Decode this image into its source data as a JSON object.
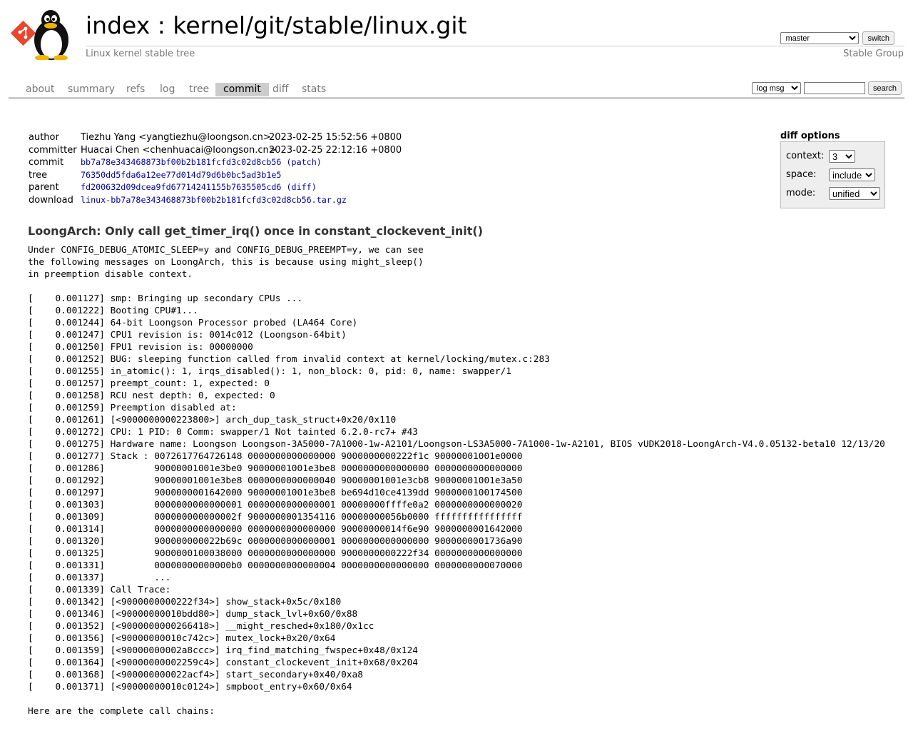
{
  "header": {
    "index_link": "index",
    "separator": ":",
    "repo_path": "kernel/git/stable/linux.git",
    "subtitle": "Linux kernel stable tree",
    "owner": "Stable Group",
    "branch_select": "master",
    "switch_button": "switch"
  },
  "tabs": [
    {
      "label": "about"
    },
    {
      "label": "summary"
    },
    {
      "label": "refs"
    },
    {
      "label": "log"
    },
    {
      "label": "tree"
    },
    {
      "label": "commit",
      "active": true
    },
    {
      "label": "diff"
    },
    {
      "label": "stats"
    }
  ],
  "search": {
    "mode_select": "log msg",
    "input_value": "",
    "button": "search"
  },
  "commit_info": {
    "author_label": "author",
    "author_value": "Tiezhu Yang <yangtiezhu@loongson.cn>",
    "author_date": "2023-02-25 15:52:56 +0800",
    "committer_label": "committer",
    "committer_value": "Huacai Chen <chenhuacai@loongson.cn>",
    "committer_date": "2023-02-25 22:12:16 +0800",
    "commit_label": "commit",
    "commit_hash": "bb7a78e343468873bf00b2b181fcfd3c02d8cb56",
    "commit_patch": "(patch)",
    "tree_label": "tree",
    "tree_hash": "76350dd5fda6a12ee77d014d79d6b0bc5ad3b1e5",
    "parent_label": "parent",
    "parent_hash": "fd200632d09dcea9fd67714241155b7635505cd6",
    "parent_diff": "(diff)",
    "download_label": "download",
    "download_link": "linux-bb7a78e343468873bf00b2b181fcfd3c02d8cb56.tar.gz"
  },
  "diff_options": {
    "title": "diff options",
    "context_label": "context:",
    "context_value": "3",
    "space_label": "space:",
    "space_value": "include",
    "mode_label": "mode:",
    "mode_value": "unified"
  },
  "commit_subject": "LoongArch: Only call get_timer_irq() once in constant_clockevent_init()",
  "commit_message": "Under CONFIG_DEBUG_ATOMIC_SLEEP=y and CONFIG_DEBUG_PREEMPT=y, we can see\nthe following messages on LoongArch, this is because using might_sleep()\nin preemption disable context.\n\n[    0.001127] smp: Bringing up secondary CPUs ...\n[    0.001222] Booting CPU#1...\n[    0.001244] 64-bit Loongson Processor probed (LA464 Core)\n[    0.001247] CPU1 revision is: 0014c012 (Loongson-64bit)\n[    0.001250] FPU1 revision is: 00000000\n[    0.001252] BUG: sleeping function called from invalid context at kernel/locking/mutex.c:283\n[    0.001255] in_atomic(): 1, irqs_disabled(): 1, non_block: 0, pid: 0, name: swapper/1\n[    0.001257] preempt_count: 1, expected: 0\n[    0.001258] RCU nest depth: 0, expected: 0\n[    0.001259] Preemption disabled at:\n[    0.001261] [<9000000000223800>] arch_dup_task_struct+0x20/0x110\n[    0.001272] CPU: 1 PID: 0 Comm: swapper/1 Not tainted 6.2.0-rc7+ #43\n[    0.001275] Hardware name: Loongson Loongson-3A5000-7A1000-1w-A2101/Loongson-LS3A5000-7A1000-1w-A2101, BIOS vUDK2018-LoongArch-V4.0.05132-beta10 12/13/20\n[    0.001277] Stack : 0072617764726148 0000000000000000 9000000000222f1c 90000001001e0000\n[    0.001286]         90000001001e3be0 90000001001e3be8 0000000000000000 0000000000000000\n[    0.001292]         90000001001e3be8 0000000000000040 90000001001e3cb8 90000001001e3a50\n[    0.001297]         9000000001642000 90000001001e3be8 be694d10ce4139dd 9000000100174500\n[    0.001303]         0000000000000001 0000000000000001 00000000ffffe0a2 0000000000000020\n[    0.001309]         000000000000002f 9000000001354116 00000000056b0000 ffffffffffffffff\n[    0.001314]         0000000000000000 0000000000000000 90000000014f6e90 9000000001642000\n[    0.001320]         900000000022b69c 0000000000000001 0000000000000000 9000000001736a90\n[    0.001325]         9000000100038000 0000000000000000 9000000000222f34 0000000000000000\n[    0.001331]         00000000000000b0 0000000000000004 0000000000000000 0000000000070000\n[    0.001337]         ...\n[    0.001339] Call Trace:\n[    0.001342] [<9000000000222f34>] show_stack+0x5c/0x180\n[    0.001346] [<90000000010bdd80>] dump_stack_lvl+0x60/0x88\n[    0.001352] [<9000000000266418>] __might_resched+0x180/0x1cc\n[    0.001356] [<90000000010c742c>] mutex_lock+0x20/0x64\n[    0.001359] [<90000000002a8ccc>] irq_find_matching_fwspec+0x48/0x124\n[    0.001364] [<90000000002259c4>] constant_clockevent_init+0x68/0x204\n[    0.001368] [<900000000022acf4>] start_secondary+0x40/0xa8\n[    0.001371] [<90000000010c0124>] smpboot_entry+0x60/0x64\n\nHere are the complete call chains:"
}
